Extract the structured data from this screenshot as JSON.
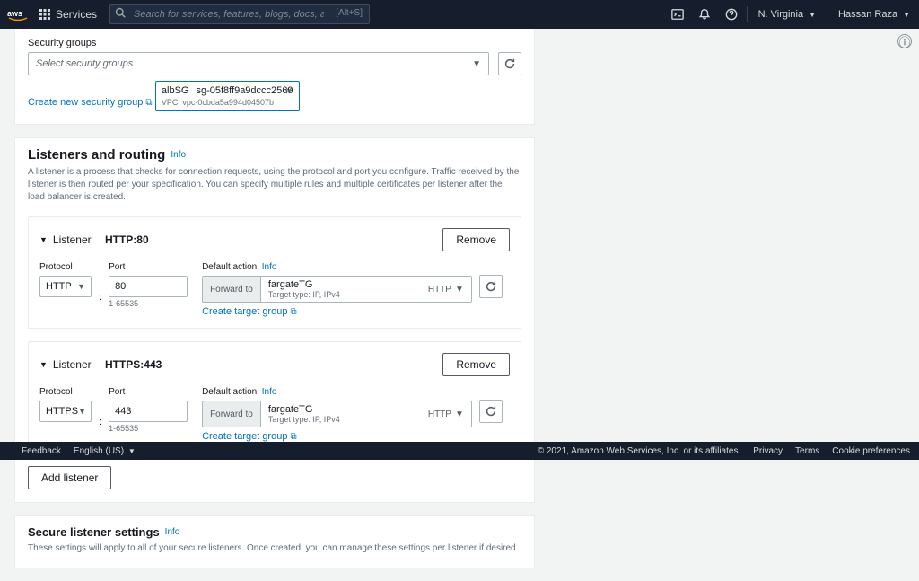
{
  "nav": {
    "services": "Services",
    "search_placeholder": "Search for services, features, blogs, docs, and more",
    "search_hint": "[Alt+S]",
    "region": "N. Virginia",
    "user": "Hassan Raza"
  },
  "sg": {
    "label": "Security groups",
    "placeholder": "Select security groups",
    "create": "Create new security group",
    "tag_name": "albSG",
    "tag_id": "sg-05f8ff9a9dccc2569",
    "tag_vpc": "VPC: vpc-0cbda5a994d04507b"
  },
  "lr": {
    "title": "Listeners and routing",
    "info": "Info",
    "desc": "A listener is a process that checks for connection requests, using the protocol and port you configure. Traffic received by the listener is then routed per your specification. You can specify multiple rules and multiple certificates per listener after the load balancer is created.",
    "remove": "Remove",
    "protocol_label": "Protocol",
    "port_label": "Port",
    "default_action_label": "Default action",
    "port_hint": "1-65535",
    "forward_to": "Forward to",
    "tg_name": "fargateTG",
    "tg_sub": "Target type: IP, IPv4",
    "create_tg": "Create target group",
    "add_listener": "Add listener",
    "listeners": [
      {
        "title_prefix": "Listener",
        "title": "HTTP:80",
        "protocol": "HTTP",
        "port": "80",
        "action_proto": "HTTP"
      },
      {
        "title_prefix": "Listener",
        "title": "HTTPS:443",
        "protocol": "HTTPS",
        "port": "443",
        "action_proto": "HTTP"
      }
    ]
  },
  "sls": {
    "title": "Secure listener settings",
    "info": "Info",
    "desc": "These settings will apply to all of your secure listeners. Once created, you can manage these settings per listener if desired."
  },
  "footer": {
    "feedback": "Feedback",
    "lang": "English (US)",
    "copy": "© 2021, Amazon Web Services, Inc. or its affiliates.",
    "privacy": "Privacy",
    "terms": "Terms",
    "cookies": "Cookie preferences"
  }
}
